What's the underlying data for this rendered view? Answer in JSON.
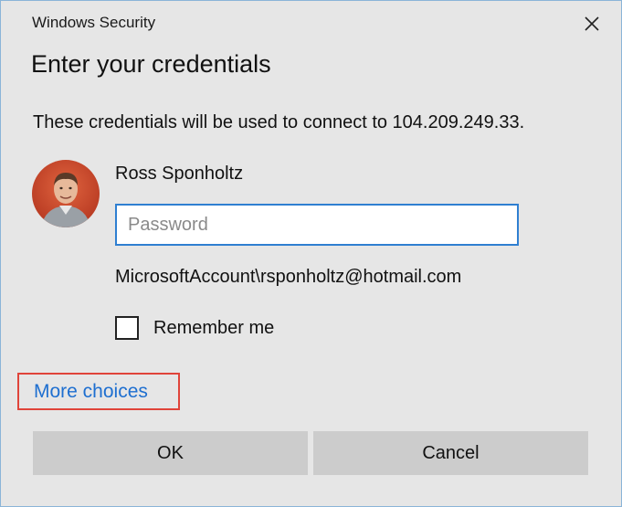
{
  "window": {
    "title": "Windows Security",
    "close_icon": "close-icon"
  },
  "dialog": {
    "heading": "Enter your credentials",
    "info_text": "These credentials will be used to connect to 104.209.249.33."
  },
  "user": {
    "display_name": "Ross Sponholtz",
    "avatar_icon": "user-photo",
    "account": "MicrosoftAccount\\rsponholtz@hotmail.com"
  },
  "password": {
    "value": "",
    "placeholder": "Password"
  },
  "remember": {
    "label": "Remember me",
    "checked": false
  },
  "links": {
    "more_choices": "More choices"
  },
  "buttons": {
    "ok": "OK",
    "cancel": "Cancel"
  },
  "colors": {
    "background": "#e6e6e6",
    "accent": "#2f7fd1",
    "link": "#1e6fd0",
    "highlight_box": "#e0443a",
    "button": "#cccccc"
  }
}
